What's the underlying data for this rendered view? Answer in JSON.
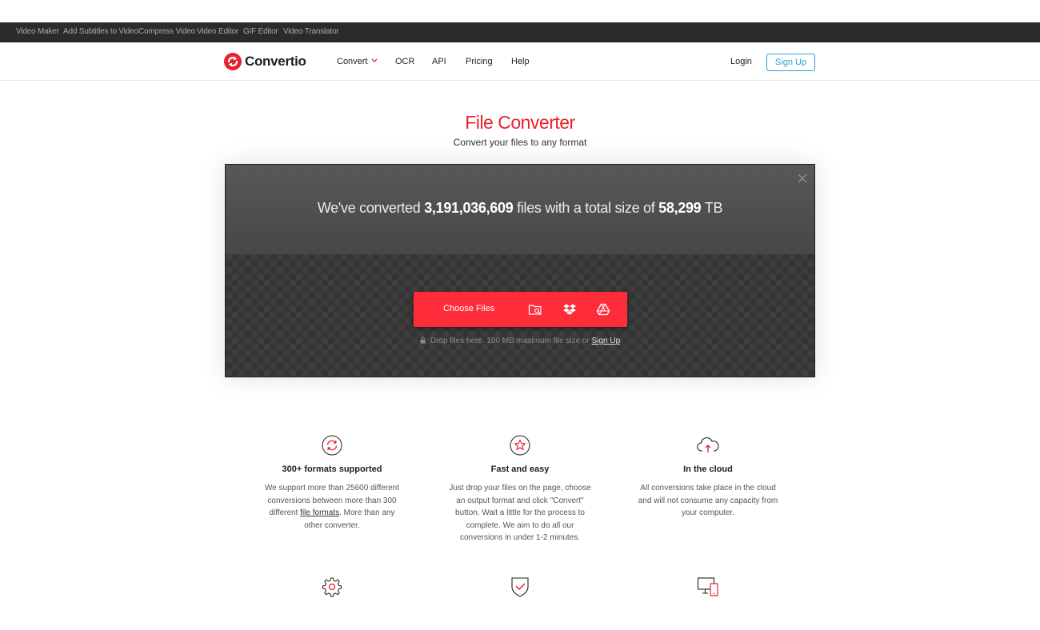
{
  "topbar": {
    "links": [
      "Video Maker",
      "Add Subtitles to Video",
      "Compress Video",
      "Video Editor",
      "GIF Editor",
      "Video Translator"
    ]
  },
  "header": {
    "brand": "Convertio",
    "nav": [
      "Convert",
      "OCR",
      "API",
      "Pricing",
      "Help"
    ],
    "login": "Login",
    "signup": "Sign Up"
  },
  "hero": {
    "title": "File Converter",
    "subtitle": "Convert your files to any format"
  },
  "converter": {
    "stats_prefix": "We've converted",
    "files_count": "3,191,036,609",
    "stats_middle": "files with a total size of",
    "total_size": "58,299",
    "size_unit": "TB",
    "choose_files": "Choose Files",
    "drop_note": "Drop files here. 100 MB maximum file size or",
    "drop_signup": "Sign Up"
  },
  "features": [
    {
      "title": "300+ formats supported",
      "text_before": "We support more than 25600 different conversions between more than 300 different",
      "link": "file formats",
      "text_after": ". More than any other converter.",
      "icon": "refresh-icon"
    },
    {
      "title": "Fast and easy",
      "text": "Just drop your files on the page, choose an output format and click \"Convert\" button. Wait a little for the process to complete. We aim to do all our conversions in under 1-2 minutes.",
      "icon": "star-icon"
    },
    {
      "title": "In the cloud",
      "text": "All conversions take place in the cloud and will not consume any capacity from your computer.",
      "icon": "cloud-upload-icon"
    }
  ],
  "features_row2_icons": [
    "gear-icon",
    "shield-check-icon",
    "devices-icon"
  ],
  "colors": {
    "brand_red": "#e8212e",
    "button_red": "#ff2c3a",
    "signup_blue": "#2a9fd8"
  }
}
